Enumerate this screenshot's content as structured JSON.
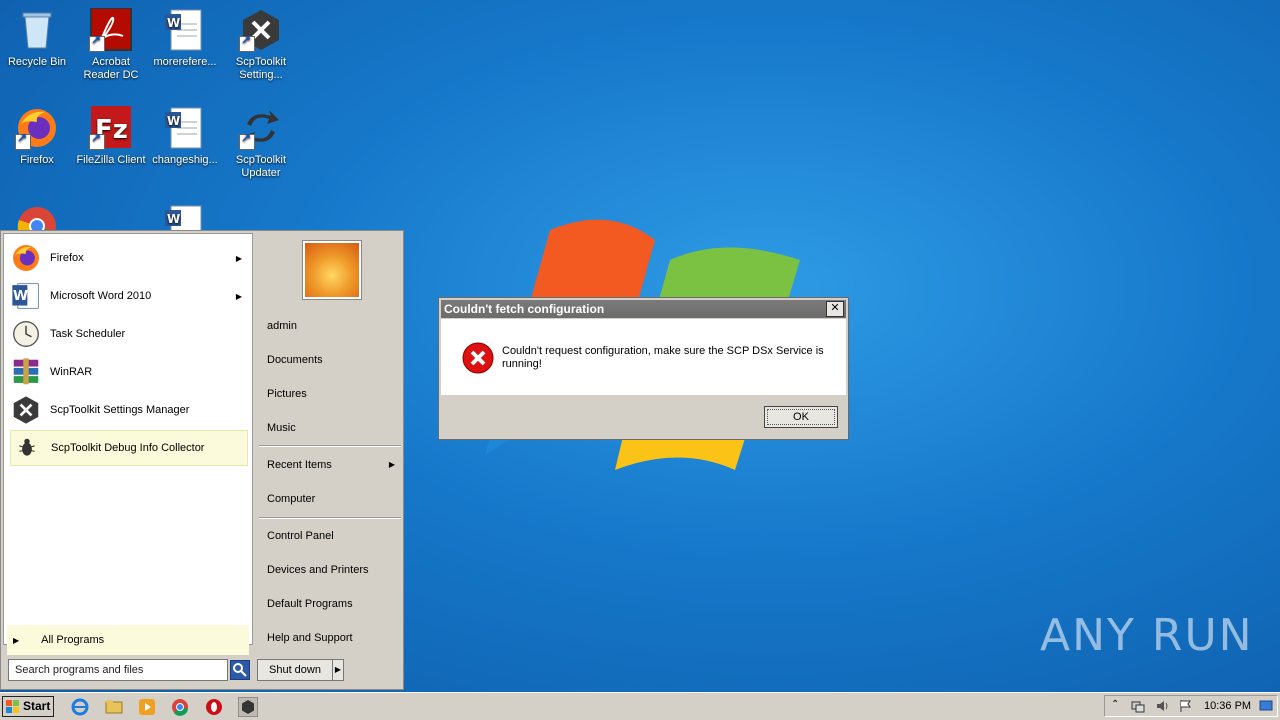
{
  "desktop": {
    "icons": [
      {
        "label": "Recycle Bin",
        "icon": "recycle-bin-icon"
      },
      {
        "label": "Acrobat Reader DC",
        "icon": "acrobat-icon"
      },
      {
        "label": "morerefere...",
        "icon": "word-doc-icon"
      },
      {
        "label": "ScpToolkit Setting...",
        "icon": "scptoolkit-icon"
      },
      {
        "label": "Firefox",
        "icon": "firefox-icon"
      },
      {
        "label": "FileZilla Client",
        "icon": "filezilla-icon"
      },
      {
        "label": "changeshig...",
        "icon": "word-doc-icon"
      },
      {
        "label": "ScpToolkit Updater",
        "icon": "updater-icon"
      },
      {
        "label": "",
        "icon": "chrome-icon"
      },
      {
        "label": "",
        "icon": "word-doc-icon"
      }
    ],
    "watermark": "ANY RUN"
  },
  "start_menu": {
    "programs": [
      {
        "label": "Firefox",
        "icon": "firefox-icon",
        "has_submenu": true
      },
      {
        "label": "Microsoft Word 2010",
        "icon": "word-icon",
        "has_submenu": true
      },
      {
        "label": "Task Scheduler",
        "icon": "clock-icon",
        "has_submenu": false
      },
      {
        "label": "WinRAR",
        "icon": "winrar-icon",
        "has_submenu": false
      },
      {
        "label": "ScpToolkit Settings Manager",
        "icon": "scptoolkit-icon",
        "has_submenu": false
      },
      {
        "label": "ScpToolkit Debug Info Collector",
        "icon": "bug-icon",
        "has_submenu": false
      }
    ],
    "all_programs": "All Programs",
    "search_placeholder": "Search programs and files",
    "right_items": [
      "admin",
      "Documents",
      "Pictures",
      "Music",
      "Recent Items",
      "Computer",
      "Control Panel",
      "Devices and Printers",
      "Default Programs",
      "Help and Support"
    ],
    "shutdown": "Shut down"
  },
  "dialog": {
    "title": "Couldn't fetch configuration",
    "message": "Couldn't request configuration, make sure the SCP DSx Service is running!",
    "ok": "OK",
    "close": "✕"
  },
  "taskbar": {
    "start": "Start",
    "clock": "10:36 PM"
  }
}
